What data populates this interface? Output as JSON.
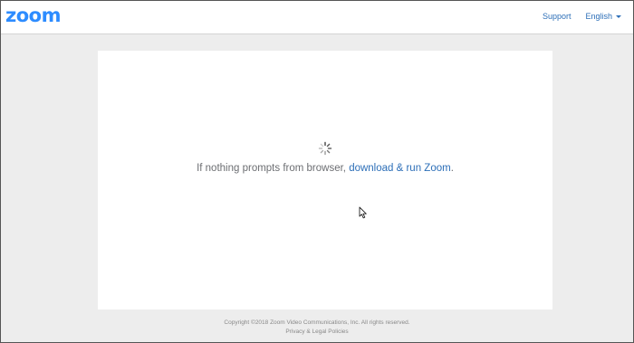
{
  "header": {
    "logo": "zoom",
    "nav": {
      "support": "Support",
      "language": "English"
    }
  },
  "main": {
    "message_text": "If nothing prompts from browser, ",
    "message_link": "download & run Zoom",
    "message_end": "."
  },
  "footer": {
    "copyright": "Copyright ©2018 Zoom Video Communications, Inc. All rights reserved.",
    "policies_link": "Privacy & Legal Policies"
  },
  "colors": {
    "brand": "#2d8cff",
    "link": "#2d6fb8",
    "background": "#ededed",
    "text": "#6c6e72"
  },
  "icons": {
    "spinner": "loading-spinner-icon",
    "cursor": "mouse-pointer-icon",
    "caret": "caret-down-icon"
  }
}
